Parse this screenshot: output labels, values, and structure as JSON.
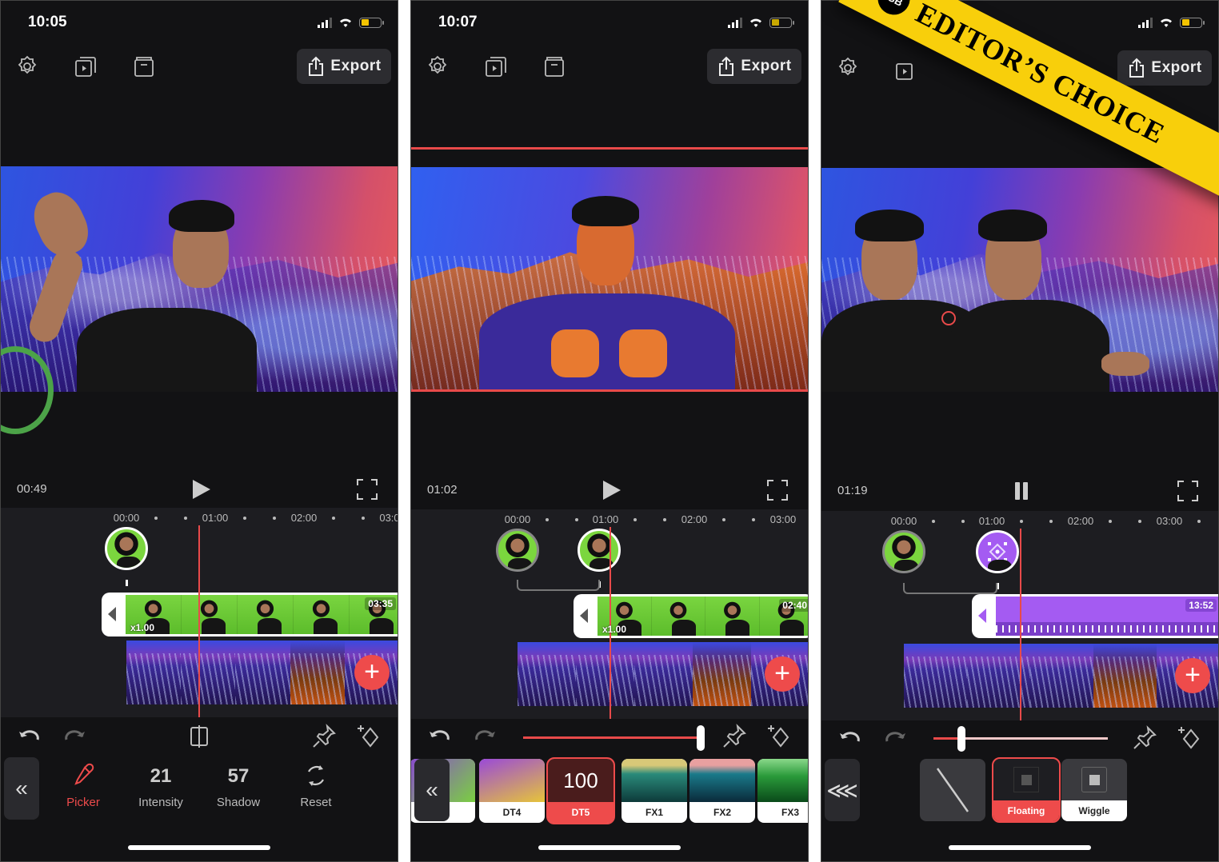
{
  "colors": {
    "accent": "#ee4b4b",
    "background": "#121214",
    "timeline_bg": "#1d1d21",
    "clip_green": "#6fd13a",
    "clip_purple": "#a45bf2",
    "banner_yellow": "#f8cf0b"
  },
  "common": {
    "export_label": "Export",
    "toolbar_icons": [
      "gear-icon",
      "preview-icon",
      "archive-icon",
      "export-icon"
    ],
    "ruler_labels": [
      "00:00",
      "01:00",
      "02:00",
      "03:00"
    ],
    "add_label": "+",
    "back_label": "«"
  },
  "screens": [
    {
      "status_time": "10:05",
      "timecode": "00:49",
      "playback_state": "paused",
      "ruler_labels": [
        "00:00",
        "01:00",
        "02:00",
        "03:0"
      ],
      "clip": {
        "speed": "x1.00",
        "duration": "03:35"
      },
      "tools": [
        {
          "icon": "eyedropper-icon",
          "label": "Picker",
          "active": true
        },
        {
          "value": "21",
          "label": "Intensity"
        },
        {
          "value": "57",
          "label": "Shadow"
        },
        {
          "icon": "reset-icon",
          "label": "Reset"
        }
      ]
    },
    {
      "status_time": "10:07",
      "timecode": "01:02",
      "playback_state": "paused",
      "ruler_labels": [
        "00:00",
        "01:00",
        "02:00",
        "03:00"
      ],
      "clip": {
        "speed": "x1.00",
        "duration": "02:40"
      },
      "slider": {
        "value": 1.0
      },
      "filters": [
        {
          "name": "3"
        },
        {
          "name": "DT4"
        },
        {
          "name": "DT5",
          "value": "100",
          "selected": true
        },
        {
          "name": "FX1"
        },
        {
          "name": "FX2"
        },
        {
          "name": "FX3"
        }
      ]
    },
    {
      "status_time": "",
      "timecode": "01:19",
      "playback_state": "playing",
      "ruler_labels": [
        "00:00",
        "01:00",
        "02:00",
        "03:00"
      ],
      "clip": {
        "duration": "13:52"
      },
      "slider": {
        "value": 0.16
      },
      "motions": [
        {
          "name": "none"
        },
        {
          "name": "Floating",
          "selected": true
        },
        {
          "name": "Wiggle"
        }
      ],
      "banner": {
        "logo": "iGB",
        "text": "EDITOR’S CHOICE"
      }
    }
  ]
}
